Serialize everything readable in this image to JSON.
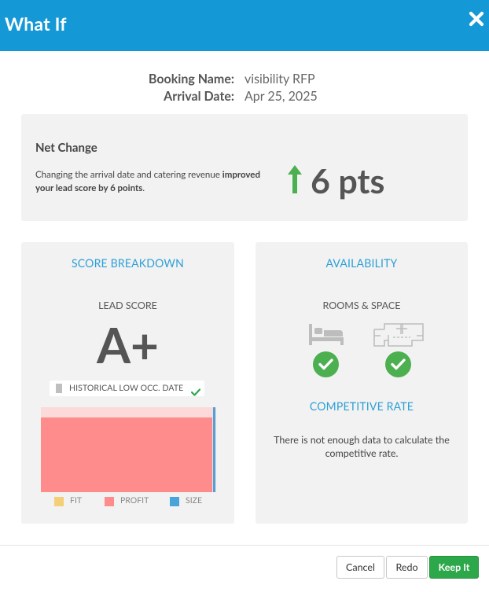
{
  "header": {
    "title": "What If"
  },
  "booking": {
    "name_label": "Booking Name:",
    "name_value": "visibility RFP",
    "arrival_label": "Arrival Date:",
    "arrival_value": "Apr 25, 2025"
  },
  "net_change": {
    "title": "Net Change",
    "desc_plain": "Changing the arrival date and catering revenue ",
    "desc_bold": "improved your lead score by 6 points",
    "desc_end": ".",
    "value": "6 pts",
    "direction_color": "#4caf50"
  },
  "score_breakdown": {
    "heading": "SCORE BREAKDOWN",
    "lead_score_label": "LEAD SCORE",
    "grade": "A+",
    "historical_badge": "HISTORICAL LOW OCC. DATE",
    "legend": [
      {
        "label": "FIT",
        "color": "#f5cf77"
      },
      {
        "label": "PROFIT",
        "color": "#ff8c8c"
      },
      {
        "label": "SIZE",
        "color": "#4aa3d9"
      }
    ]
  },
  "availability": {
    "heading": "AVAILABILITY",
    "rooms_label": "ROOMS & SPACE",
    "competitive_heading": "COMPETITIVE RATE",
    "competitive_text": "There is not enough data to calculate the competitive rate."
  },
  "footer": {
    "cancel": "Cancel",
    "redo": "Redo",
    "keep": "Keep It"
  }
}
